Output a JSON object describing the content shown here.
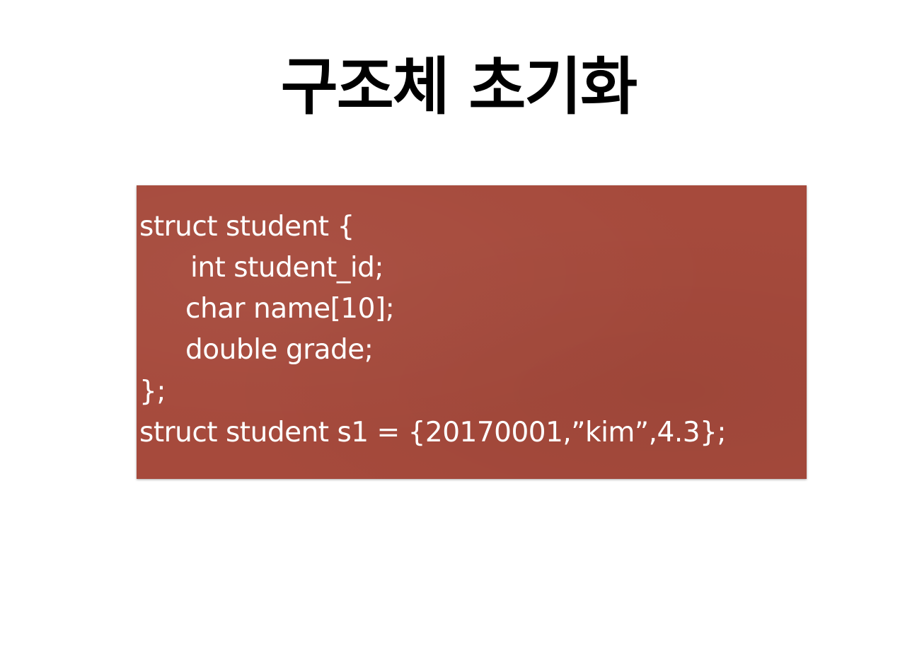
{
  "slide": {
    "title": "구조체 초기화",
    "code_lines": [
      "struct student {",
      "int student_id;",
      "char name[10];",
      "double grade;",
      "};",
      "struct student s1 = {20170001,”kim”,4.3};"
    ],
    "colors": {
      "background": "#ffffff",
      "code_box": "#a64a3c",
      "code_text": "#ffffff",
      "title_text": "#000000"
    }
  }
}
